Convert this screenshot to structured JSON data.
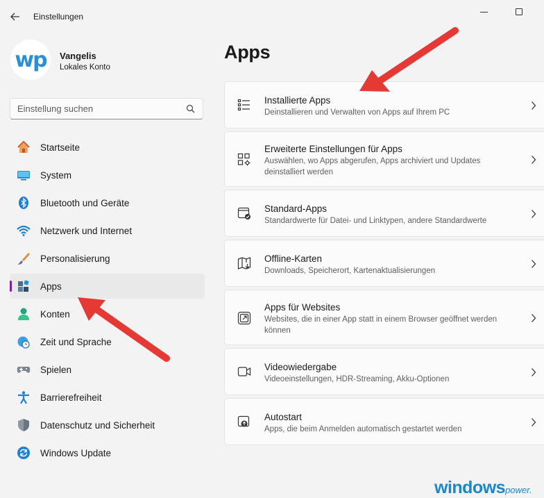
{
  "window": {
    "title": "Einstellungen"
  },
  "user": {
    "avatar_text": "wp",
    "name": "Vangelis",
    "account_type": "Lokales Konto"
  },
  "search": {
    "placeholder": "Einstellung suchen"
  },
  "sidebar": {
    "selected": "Apps",
    "items": [
      {
        "label": "Startseite",
        "icon": "home-icon"
      },
      {
        "label": "System",
        "icon": "monitor-icon"
      },
      {
        "label": "Bluetooth und Geräte",
        "icon": "bluetooth-icon"
      },
      {
        "label": "Netzwerk und Internet",
        "icon": "wifi-icon"
      },
      {
        "label": "Personalisierung",
        "icon": "brush-icon"
      },
      {
        "label": "Apps",
        "icon": "apps-icon"
      },
      {
        "label": "Konten",
        "icon": "person-icon"
      },
      {
        "label": "Zeit und Sprache",
        "icon": "globe-clock-icon"
      },
      {
        "label": "Spielen",
        "icon": "gamepad-icon"
      },
      {
        "label": "Barrierefreiheit",
        "icon": "accessibility-icon"
      },
      {
        "label": "Datenschutz und Sicherheit",
        "icon": "shield-icon"
      },
      {
        "label": "Windows Update",
        "icon": "update-icon"
      }
    ]
  },
  "main": {
    "title": "Apps",
    "cards": [
      {
        "title": "Installierte Apps",
        "desc": "Deinstallieren und Verwalten von Apps auf Ihrem PC",
        "icon": "list-icon"
      },
      {
        "title": "Erweiterte Einstellungen für Apps",
        "desc": "Auswählen, wo Apps abgerufen, Apps archiviert und Updates deinstalliert werden",
        "icon": "apps-settings-icon"
      },
      {
        "title": "Standard-Apps",
        "desc": "Standardwerte für Datei- und Linktypen, andere Standardwerte",
        "icon": "default-apps-icon"
      },
      {
        "title": "Offline-Karten",
        "desc": "Downloads, Speicherort, Kartenaktualisierungen",
        "icon": "map-icon"
      },
      {
        "title": "Apps für Websites",
        "desc": "Websites, die in einer App statt in einem Browser geöffnet werden können",
        "icon": "open-external-icon"
      },
      {
        "title": "Videowiedergabe",
        "desc": "Videoeinstellungen, HDR-Streaming, Akku-Optionen",
        "icon": "video-icon"
      },
      {
        "title": "Autostart",
        "desc": "Apps, die beim Anmelden automatisch gestartet werden",
        "icon": "startup-icon"
      }
    ]
  },
  "watermark": {
    "brand": "windows",
    "suffix": "power."
  },
  "colors": {
    "accent_selected": "#7b1fa2",
    "arrow": "#e53935",
    "watermark": "#1b87c8"
  }
}
